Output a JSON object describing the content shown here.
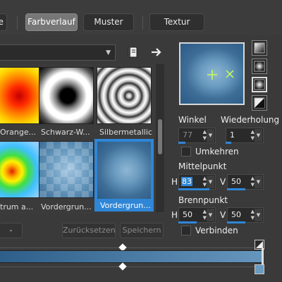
{
  "tabs": [
    {
      "label": "e",
      "active": false
    },
    {
      "label": "Farbverlauf",
      "active": true
    },
    {
      "label": "Muster",
      "active": false
    },
    {
      "label": "Textur",
      "active": false
    }
  ],
  "gallery": {
    "items": [
      {
        "label": "Orange..."
      },
      {
        "label": "Schwarz-W..."
      },
      {
        "label": "Silbermetallic"
      },
      {
        "label": "trum a..."
      },
      {
        "label": "Vordergrun..."
      },
      {
        "label": "Vordergrun...",
        "selected": true
      }
    ]
  },
  "buttons": {
    "minus": "-",
    "reset": "Zurücksetzen",
    "save": "Speichern"
  },
  "properties": {
    "angle_label": "Winkel",
    "angle_value": "77",
    "repeat_label": "Wiederholung",
    "repeat_value": "1",
    "invert_label": "Umkehren",
    "center_label": "Mittelpunkt",
    "center_h_label": "H",
    "center_h_value": "83",
    "center_v_label": "V",
    "center_v_value": "50",
    "focus_label": "Brennpunkt",
    "focus_h_label": "H",
    "focus_h_value": "50",
    "focus_v_label": "V",
    "focus_v_value": "50",
    "link_label": "Verbinden"
  },
  "colors": {
    "accent": "#2f86d6",
    "gradient_start": "#2e5f8a",
    "gradient_end": "#6696bd"
  }
}
